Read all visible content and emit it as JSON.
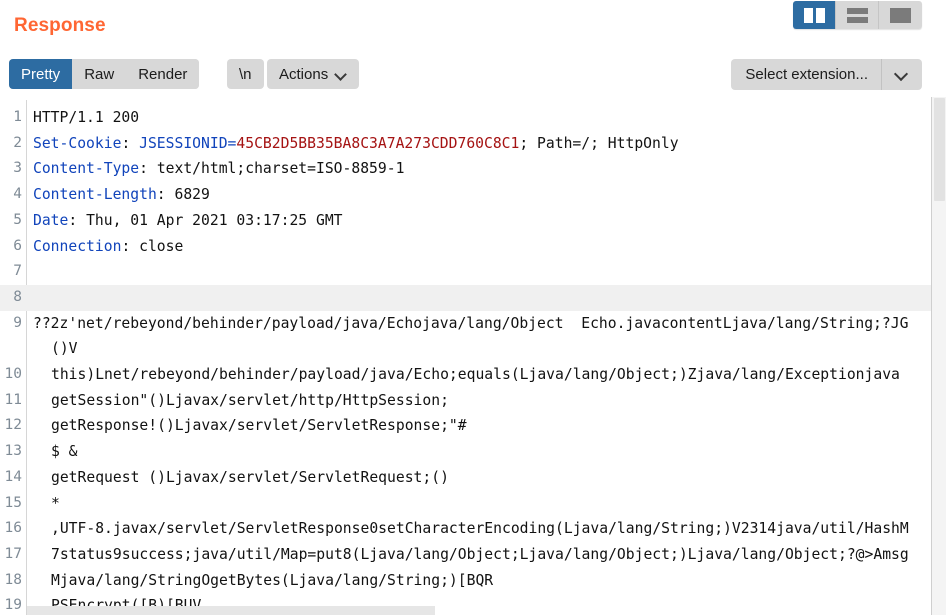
{
  "panel": {
    "title": "Response"
  },
  "layout_toggle": {
    "buttons": [
      {
        "name": "side-by-side-layout",
        "icon": "split-vertical-icon",
        "active": true
      },
      {
        "name": "stacked-layout",
        "icon": "split-horizontal-icon",
        "active": false
      },
      {
        "name": "single-pane-layout",
        "icon": "single-pane-icon",
        "active": false
      }
    ]
  },
  "toolbar": {
    "pretty_label": "Pretty",
    "raw_label": "Raw",
    "render_label": "Render",
    "newline_label": "\\n",
    "actions_label": "Actions",
    "selected_view": "Pretty"
  },
  "extension_select": {
    "value": "Select extension...",
    "icon": "chevron-down-icon"
  },
  "response": {
    "status_line": "HTTP/1.1 200",
    "headers": [
      {
        "name": "Set-Cookie",
        "value": "JSESSIONID=45CB2D5BB35BA8C3A7A273CDD760C8C1; Path=/; HttpOnly",
        "cookie_name": "JSESSIONID=",
        "cookie_value": "45CB2D5BB35BA8C3A7A273CDD760C8C1",
        "cookie_attrs": "; Path=/; HttpOnly"
      },
      {
        "name": "Content-Type",
        "value": "text/html;charset=ISO-8859-1"
      },
      {
        "name": "Content-Length",
        "value": "6829"
      },
      {
        "name": "Date",
        "value": "Thu, 01 Apr 2021 03:17:25 GMT"
      },
      {
        "name": "Connection",
        "value": "close"
      }
    ],
    "body_lines": [
      {
        "number": 7,
        "text": ""
      },
      {
        "number": 8,
        "text": "",
        "highlighted": true
      },
      {
        "number": 9,
        "text": "??2z'net/rebeyond/behinder/payload/java/Echojava/lang/Object  Echo.javacontentLjava/lang/String;?JG",
        "continuation": "()V"
      },
      {
        "number": 10,
        "text": "this)Lnet/rebeyond/behinder/payload/java/Echo;equals(Ljava/lang/Object;)Zjava/lang/Exceptionjava"
      },
      {
        "number": 11,
        "text": "getSession\"()Ljavax/servlet/http/HttpSession;"
      },
      {
        "number": 12,
        "text": "getResponse!()Ljavax/servlet/ServletResponse;\"#"
      },
      {
        "number": 13,
        "text": "$ &"
      },
      {
        "number": 14,
        "text": "getRequest ()Ljavax/servlet/ServletRequest;()"
      },
      {
        "number": 15,
        "text": "*"
      },
      {
        "number": 16,
        "text": ",UTF-8.javax/servlet/ServletResponse0setCharacterEncoding(Ljava/lang/String;)V2314java/util/HashM"
      },
      {
        "number": 17,
        "text": "7status9success;java/util/Map=put8(Ljava/lang/Object;Ljava/lang/Object;)Ljava/lang/Object;?@>Amsg"
      },
      {
        "number": 18,
        "text": "Mjava/lang/StringOgetBytes(Ljava/lang/String;)[BQR"
      },
      {
        "number": 19,
        "text": "PSEncrypt([B)[BUV"
      }
    ]
  },
  "colors": {
    "accent_orange": "#ff6633",
    "selected_blue": "#2d6ca2",
    "header_blue": "#1144bb",
    "cookie_red": "#a51313",
    "button_gray": "#d8d8d8",
    "highlight_row": "#f0f0f0"
  }
}
